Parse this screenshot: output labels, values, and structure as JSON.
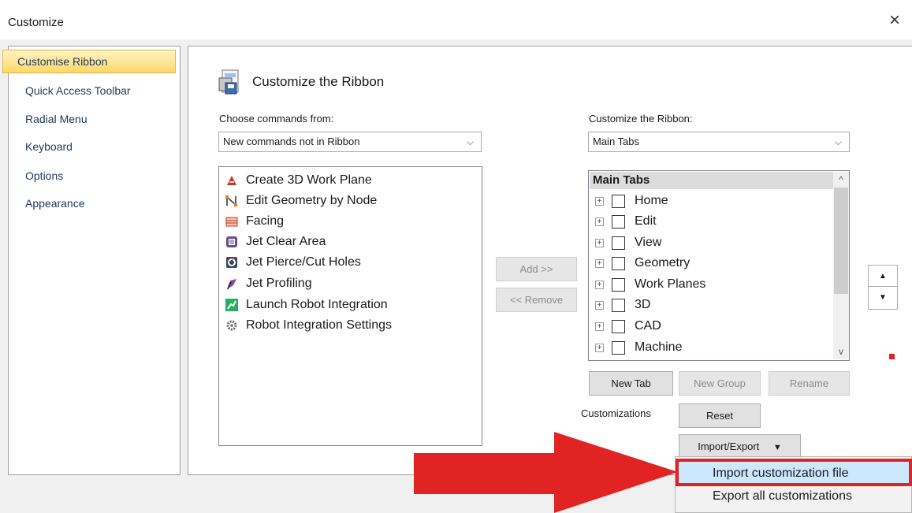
{
  "window": {
    "title": "Customize",
    "close_glyph": "×"
  },
  "nav": {
    "items": [
      {
        "label": "Customise Ribbon",
        "selected": true
      },
      {
        "label": "Quick Access Toolbar"
      },
      {
        "label": "Radial Menu"
      },
      {
        "label": "Keyboard"
      },
      {
        "label": "Options"
      },
      {
        "label": "Appearance"
      }
    ]
  },
  "main": {
    "heading": "Customize the Ribbon",
    "left": {
      "label": "Choose commands from:",
      "combo_value": "New commands not in Ribbon",
      "commands": [
        {
          "label": "Create 3D Work Plane",
          "icon": "workplane-icon"
        },
        {
          "label": "Edit Geometry by Node",
          "icon": "edit-node-icon"
        },
        {
          "label": "Facing",
          "icon": "facing-icon"
        },
        {
          "label": "Jet Clear Area",
          "icon": "jet-clear-icon"
        },
        {
          "label": "Jet Pierce/Cut Holes",
          "icon": "jet-pierce-icon"
        },
        {
          "label": "Jet Profiling",
          "icon": "jet-profiling-icon"
        },
        {
          "label": "Launch Robot Integration",
          "icon": "robot-launch-icon"
        },
        {
          "label": "Robot Integration Settings",
          "icon": "gear-icon"
        }
      ]
    },
    "middle": {
      "add_label": "Add >>",
      "remove_label": "<< Remove"
    },
    "right": {
      "label": "Customize the Ribbon:",
      "combo_value": "Main Tabs",
      "tree_header": "Main Tabs",
      "tabs": [
        "Home",
        "Edit",
        "View",
        "Geometry",
        "Work Planes",
        "3D",
        "CAD",
        "Machine"
      ],
      "expand_glyph": "+",
      "scroll_up": "^",
      "scroll_down": "v"
    },
    "buttons": {
      "new_tab": "New Tab",
      "new_group": "New Group",
      "rename": "Rename"
    },
    "customizations_label": "Customizations",
    "reset_label": "Reset",
    "import_export_label": "Import/Export",
    "import_export_arrow": "▼",
    "move_up_glyph": "▲",
    "move_down_glyph": "▼",
    "dropdown_chevron": "⌵",
    "menu_items": [
      {
        "label": "Import customization file",
        "highlighted": true
      },
      {
        "label": "Export all customizations"
      }
    ]
  },
  "colors": {
    "annotation_red": "#e22323",
    "selected_nav": "#ffd76a",
    "menu_highlight": "#cce8ff"
  }
}
